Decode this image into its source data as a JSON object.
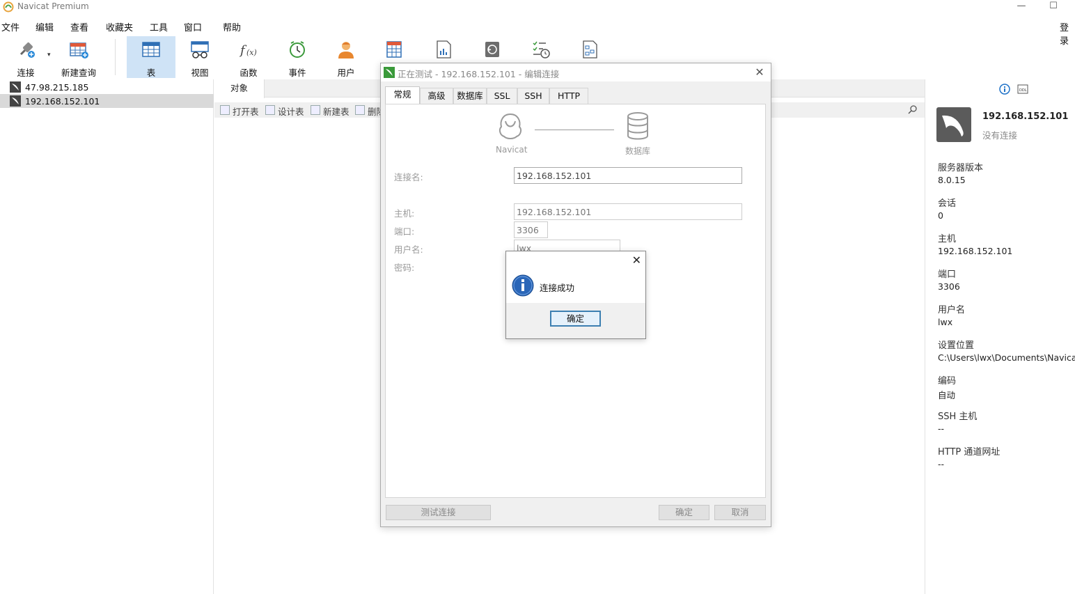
{
  "window": {
    "title": "Navicat Premium",
    "login_label": "登录"
  },
  "menu": [
    "文件",
    "编辑",
    "查看",
    "收藏夹",
    "工具",
    "窗口",
    "帮助"
  ],
  "toolbar": {
    "connect": "连接",
    "new_query": "新建查询",
    "table": "表",
    "view": "视图",
    "function": "函数",
    "event": "事件",
    "user": "用户"
  },
  "connections": [
    "47.98.215.185",
    "192.168.152.101"
  ],
  "object_panel": {
    "tab": "对象",
    "actions": [
      "打开表",
      "设计表",
      "新建表",
      "删除"
    ]
  },
  "info_panel": {
    "name": "192.168.152.101",
    "status": "没有连接",
    "fields": [
      {
        "label": "服务器版本",
        "value": "8.0.15"
      },
      {
        "label": "会话",
        "value": "0"
      },
      {
        "label": "主机",
        "value": "192.168.152.101"
      },
      {
        "label": "端口",
        "value": "3306"
      },
      {
        "label": "用户名",
        "value": "lwx"
      },
      {
        "label": "设置位置",
        "value": "C:\\Users\\lwx\\Documents\\Navicat\\M"
      },
      {
        "label": "编码",
        "value": "自动"
      },
      {
        "label": "SSH 主机",
        "value": "--"
      },
      {
        "label": "HTTP 通道网址",
        "value": "--"
      }
    ]
  },
  "dialog": {
    "title": "正在测试 - 192.168.152.101 - 编辑连接",
    "tabs": [
      "常规",
      "高级",
      "数据库",
      "SSL",
      "SSH",
      "HTTP"
    ],
    "flow_left": "Navicat",
    "flow_right": "数据库",
    "labels": {
      "conn_name": "连接名:",
      "host": "主机:",
      "port": "端口:",
      "username": "用户名:",
      "password": "密码:"
    },
    "values": {
      "conn_name": "192.168.152.101",
      "host": "192.168.152.101",
      "port": "3306",
      "username": "lwx"
    },
    "buttons": {
      "test": "测试连接",
      "ok": "确定",
      "cancel": "取消"
    }
  },
  "message_box": {
    "text": "连接成功",
    "ok": "确定"
  }
}
